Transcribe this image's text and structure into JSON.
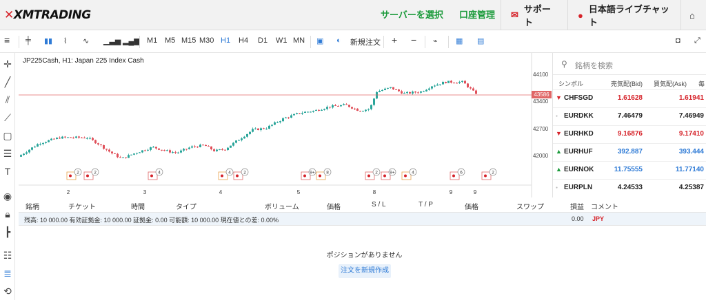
{
  "header": {
    "logo": "XMTRADING",
    "server_select": "サーバーを選択",
    "account_mgmt": "口座管理",
    "support": "サポート",
    "live_chat": "日本語ライブチャット"
  },
  "toolbar": {
    "timeframes": [
      "M1",
      "M5",
      "M15",
      "M30",
      "H1",
      "H4",
      "D1",
      "W1",
      "MN"
    ],
    "active_timeframe": "H1",
    "new_order": "新規注文",
    "plus": "+",
    "minus": "−"
  },
  "chart": {
    "title": "JP225Cash, H1: Japan 225 Index Cash",
    "current_price": "43586",
    "price_ticks": [
      "44100",
      "43400",
      "42700",
      "42000"
    ],
    "date_ticks": [
      "2",
      "3",
      "4",
      "5",
      "8",
      "9",
      "9"
    ],
    "markers": [
      "2",
      "2",
      "4",
      "4",
      "2",
      "9+",
      "8",
      "2",
      "9+",
      "4",
      "6",
      "2"
    ],
    "colors": {
      "up": "#2aa59a",
      "down": "#e0505a",
      "price_line": "#e06666"
    }
  },
  "watchlist": {
    "search_placeholder": "銘柄を検索",
    "headers": {
      "symbol": "シンボル",
      "bid": "売気配(Bid)",
      "ask": "買気配(Ask)",
      "more": "毎"
    },
    "rows": [
      {
        "symbol": "CHFSGD",
        "bid": "1.61628",
        "ask": "1.61941",
        "dir": "down"
      },
      {
        "symbol": "EURDKK",
        "bid": "7.46479",
        "ask": "7.46949",
        "dir": "flat"
      },
      {
        "symbol": "EURHKD",
        "bid": "9.16876",
        "ask": "9.17410",
        "dir": "down"
      },
      {
        "symbol": "EURHUF",
        "bid": "392.887",
        "ask": "393.444",
        "dir": "up"
      },
      {
        "symbol": "EURNOK",
        "bid": "11.75555",
        "ask": "11.77140",
        "dir": "up"
      },
      {
        "symbol": "EURPLN",
        "bid": "4.24533",
        "ask": "4.25387",
        "dir": "flat"
      }
    ]
  },
  "positions": {
    "headers": [
      "銘柄",
      "チケット",
      "時間",
      "タイプ",
      "ボリューム",
      "価格",
      "S / L",
      "T / P",
      "価格",
      "スワップ",
      "損益",
      "コメント"
    ],
    "summary": "残高: 10 000.00    有効証拠金: 10 000.00    証拠金: 0.00    可能額: 10 000.00    現在値との差: 0.00%",
    "profit": "0.00",
    "currency": "JPY",
    "empty_message": "ポジションがありません",
    "new_order_button": "注文を新規作成"
  }
}
